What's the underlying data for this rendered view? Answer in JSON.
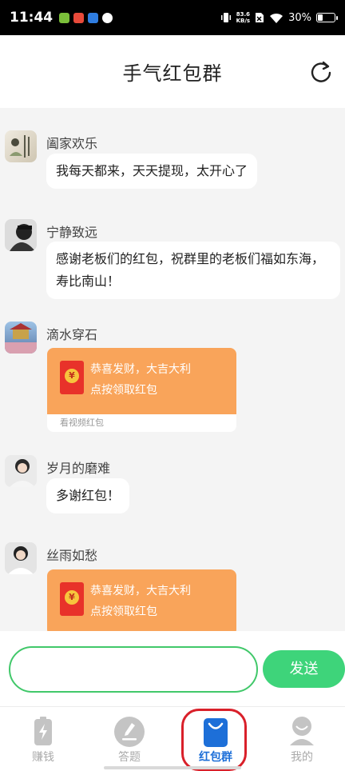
{
  "status_bar": {
    "time": "11:44",
    "net_speed_value": "83.6",
    "net_speed_unit": "KB/s",
    "battery": "30%",
    "battery_level": 0.3
  },
  "header": {
    "title": "手气红包群",
    "refresh_icon": "refresh-icon"
  },
  "messages": [
    {
      "user": "阖家欢乐",
      "type": "text",
      "text": "我每天都来，天天提现，太开心了"
    },
    {
      "user": "宁静致远",
      "type": "text",
      "lines": [
        "感谢老板们的红包，祝群里的老板们福如东海，",
        "寿比南山！"
      ]
    },
    {
      "user": "滴水穿石",
      "type": "red_packet",
      "line1": "恭喜发财，大吉大利",
      "line2": "点按领取红包",
      "footer": "看视频红包",
      "coin": "¥"
    },
    {
      "user": "岁月的磨难",
      "type": "text",
      "text": "多谢红包！"
    },
    {
      "user": "丝雨如愁",
      "type": "red_packet",
      "line1": "恭喜发财，大吉大利",
      "line2": "点按领取红包",
      "coin": "¥"
    }
  ],
  "input": {
    "placeholder": "",
    "send_label": "发送"
  },
  "tabs": [
    {
      "label": "赚钱",
      "icon": "battery-bolt-icon",
      "active": false
    },
    {
      "label": "答题",
      "icon": "pen-circle-icon",
      "active": false
    },
    {
      "label": "红包群",
      "icon": "bag-icon",
      "active": true
    },
    {
      "label": "我的",
      "icon": "person-icon",
      "active": false
    }
  ],
  "colors": {
    "accent_green": "#3ed47a",
    "red_packet_orange": "#f9a45a",
    "active_tab_blue": "#1d6fd8",
    "highlight_red": "#d9202a"
  }
}
